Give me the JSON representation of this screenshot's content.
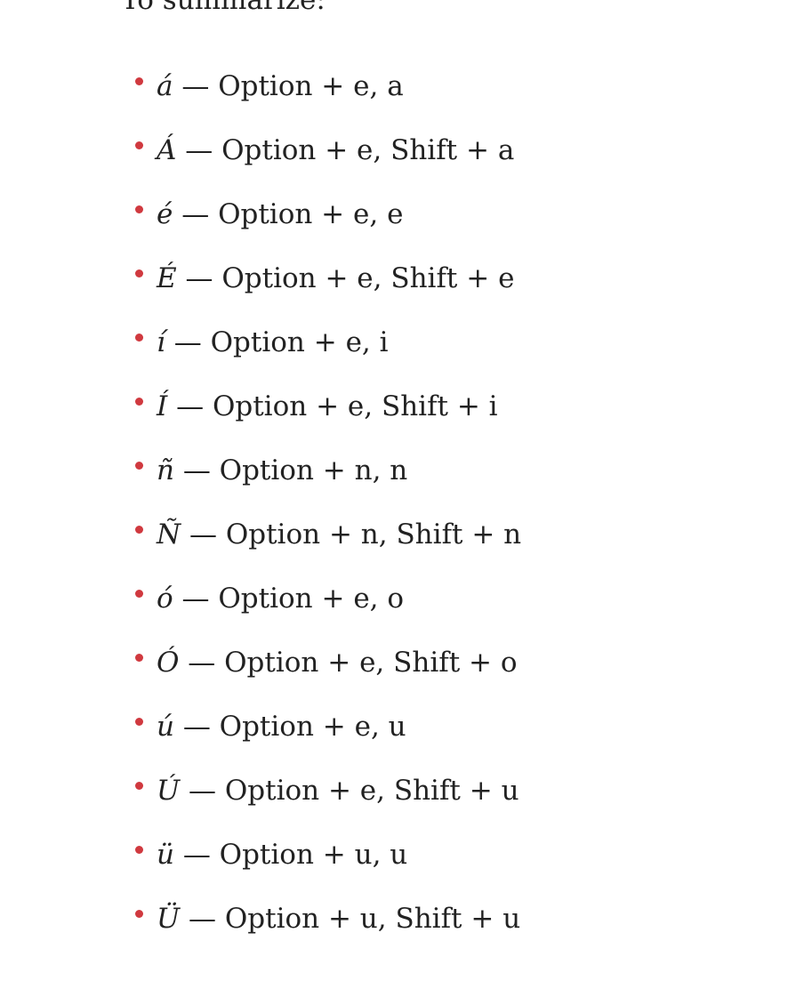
{
  "intro": "To summarize:",
  "bullet_color": "#d0393f",
  "shortcuts": [
    {
      "char": "á",
      "desc": " — Option + e, a"
    },
    {
      "char": "Á",
      "desc": " — Option + e, Shift + a"
    },
    {
      "char": "é",
      "desc": " — Option + e, e"
    },
    {
      "char": "É",
      "desc": " — Option + e, Shift + e"
    },
    {
      "char": "í",
      "desc": " — Option + e, i"
    },
    {
      "char": "Í",
      "desc": " — Option + e, Shift + i"
    },
    {
      "char": "ñ",
      "desc": " — Option + n, n"
    },
    {
      "char": "Ñ",
      "desc": " — Option + n, Shift + n"
    },
    {
      "char": "ó",
      "desc": " — Option + e, o"
    },
    {
      "char": "Ó",
      "desc": " — Option + e, Shift + o"
    },
    {
      "char": "ú",
      "desc": " — Option + e, u"
    },
    {
      "char": "Ú",
      "desc": " — Option + e, Shift + u"
    },
    {
      "char": "ü",
      "desc": " — Option + u, u"
    },
    {
      "char": "Ü",
      "desc": " — Option + u, Shift + u"
    }
  ]
}
